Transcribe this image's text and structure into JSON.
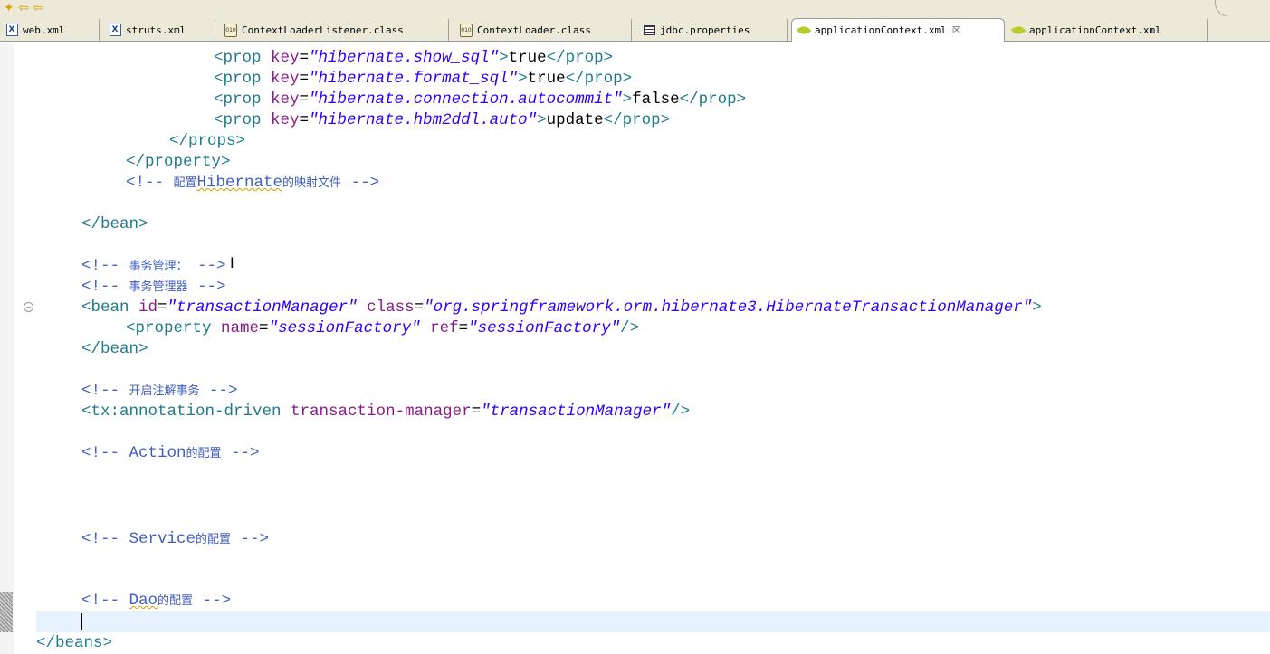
{
  "toolbar": {
    "glyphs": "✦ ⇦ ⇦"
  },
  "tabs": [
    {
      "label": "web.xml",
      "icon": "xml-file-icon",
      "active": false
    },
    {
      "label": "struts.xml",
      "icon": "xml-file-icon",
      "active": false
    },
    {
      "label": "ContextLoaderListener.class",
      "icon": "class-file-icon",
      "active": false
    },
    {
      "label": "ContextLoader.class",
      "icon": "class-file-icon",
      "active": false
    },
    {
      "label": "jdbc.properties",
      "icon": "properties-file-icon",
      "active": false
    },
    {
      "label": "applicationContext.xml",
      "icon": "spring-leaf-icon",
      "active": true,
      "close": "☒"
    },
    {
      "label": "applicationContext.xml",
      "icon": "spring-leaf-icon",
      "active": false
    }
  ],
  "icons": {
    "xml": "X",
    "class": "010"
  },
  "code": {
    "l1": {
      "t1": "<prop ",
      "a": "key",
      "e": "=",
      "v": "\"hibernate.show_sql\"",
      "t2": ">",
      "x": "true",
      "t3": "</prop>"
    },
    "l2": {
      "t1": "<prop ",
      "a": "key",
      "e": "=",
      "v": "\"hibernate.format_sql\"",
      "t2": ">",
      "x": "true",
      "t3": "</prop>"
    },
    "l3": {
      "t1": "<prop ",
      "a": "key",
      "e": "=",
      "v": "\"hibernate.connection.autocommit\"",
      "t2": ">",
      "x": "false",
      "t3": "</prop>"
    },
    "l4": {
      "t1": "<prop ",
      "a": "key",
      "e": "=",
      "v": "\"hibernate.hbm2ddl.auto\"",
      "t2": ">",
      "x": "update",
      "t3": "</prop>"
    },
    "l5": "</props>",
    "l6": "</property>",
    "l7": {
      "c1": "<!-- ",
      "zh1": "配置",
      "en": "Hibernate",
      "zh2": "的映射文件",
      "c2": " -->"
    },
    "l8": "</bean>",
    "l9": {
      "c1": "<!-- ",
      "zh1": "事务管理：",
      "c2": " -->"
    },
    "l10": {
      "c1": "<!-- ",
      "zh1": "事务管理器",
      "c2": " -->"
    },
    "l11": {
      "t1": "<bean ",
      "a1": "id",
      "v1": "\"transactionManager\"",
      "a2": "class",
      "v2": "\"org.springframework.orm.hibernate3.HibernateTransactionManager\"",
      "t2": ">"
    },
    "l12": {
      "t1": "<property ",
      "a1": "name",
      "v1": "\"sessionFactory\"",
      "a2": "ref",
      "v2": "\"sessionFactory\"",
      "t2": "/>"
    },
    "l13": "</bean>",
    "l14": {
      "c1": "<!-- ",
      "zh1": "开启注解事务",
      "c2": " -->"
    },
    "l15": {
      "t1": "<tx:annotation-driven ",
      "a1": "transaction-manager",
      "v1": "\"transactionManager\"",
      "t2": "/>"
    },
    "l16": {
      "c1": "<!-- ",
      "en": "Action",
      "zh1": "的配置",
      "c2": " -->"
    },
    "l17": {
      "c1": "<!-- ",
      "en": "Service",
      "zh1": "的配置",
      "c2": " -->"
    },
    "l18": {
      "c1": "<!-- ",
      "en": "Dao",
      "zh1": "的配置",
      "c2": " -->"
    },
    "l19": "</beans>"
  },
  "colors": {
    "tag": "#1e7a8c",
    "attribute": "#8a1a8a",
    "value": "#2a00ff",
    "comment": "#3f5fbf",
    "current_line": "#e8f2fe"
  }
}
